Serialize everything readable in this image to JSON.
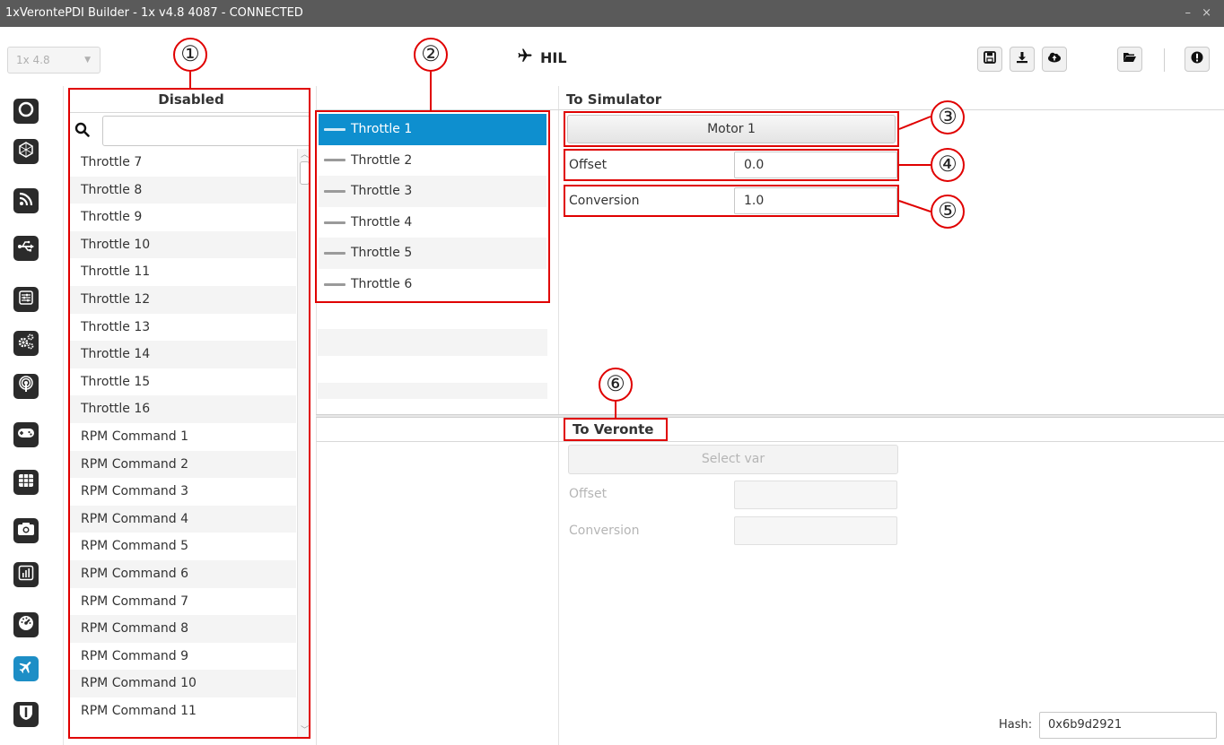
{
  "window": {
    "title": "1xVerontePDI Builder - 1x v4.8 4087 - CONNECTED",
    "controls": "– ×"
  },
  "toolbar": {
    "version": "1x 4.8",
    "page_title": "HIL"
  },
  "disabled": {
    "header": "Disabled",
    "items": [
      "Throttle 7",
      "Throttle 8",
      "Throttle 9",
      "Throttle 10",
      "Throttle 11",
      "Throttle 12",
      "Throttle 13",
      "Throttle 14",
      "Throttle 15",
      "Throttle 16",
      "RPM Command 1",
      "RPM Command 2",
      "RPM Command 3",
      "RPM Command 4",
      "RPM Command 5",
      "RPM Command 6",
      "RPM Command 7",
      "RPM Command 8",
      "RPM Command 9",
      "RPM Command 10",
      "RPM Command 11"
    ]
  },
  "enabled": {
    "items": [
      "Throttle 1",
      "Throttle 2",
      "Throttle 3",
      "Throttle 4",
      "Throttle 5",
      "Throttle 6"
    ],
    "selected": 0
  },
  "to_simulator": {
    "header": "To Simulator",
    "var_button": "Motor 1",
    "offset_label": "Offset",
    "offset": "0.0",
    "conversion_label": "Conversion",
    "conversion": "1.0"
  },
  "to_veronte": {
    "header": "To Veronte",
    "var_button": "Select var",
    "offset_label": "Offset",
    "conversion_label": "Conversion"
  },
  "hash": {
    "label": "Hash:",
    "value": "0x6b9d2921"
  },
  "callouts": [
    "①",
    "②",
    "③",
    "④",
    "⑤",
    "⑥"
  ],
  "colors": {
    "annotation": "#e00000",
    "selection": "#0e8fcf",
    "sidebar_icon": "#2b2b2b",
    "sidebar_active": "#1d8ec6"
  }
}
